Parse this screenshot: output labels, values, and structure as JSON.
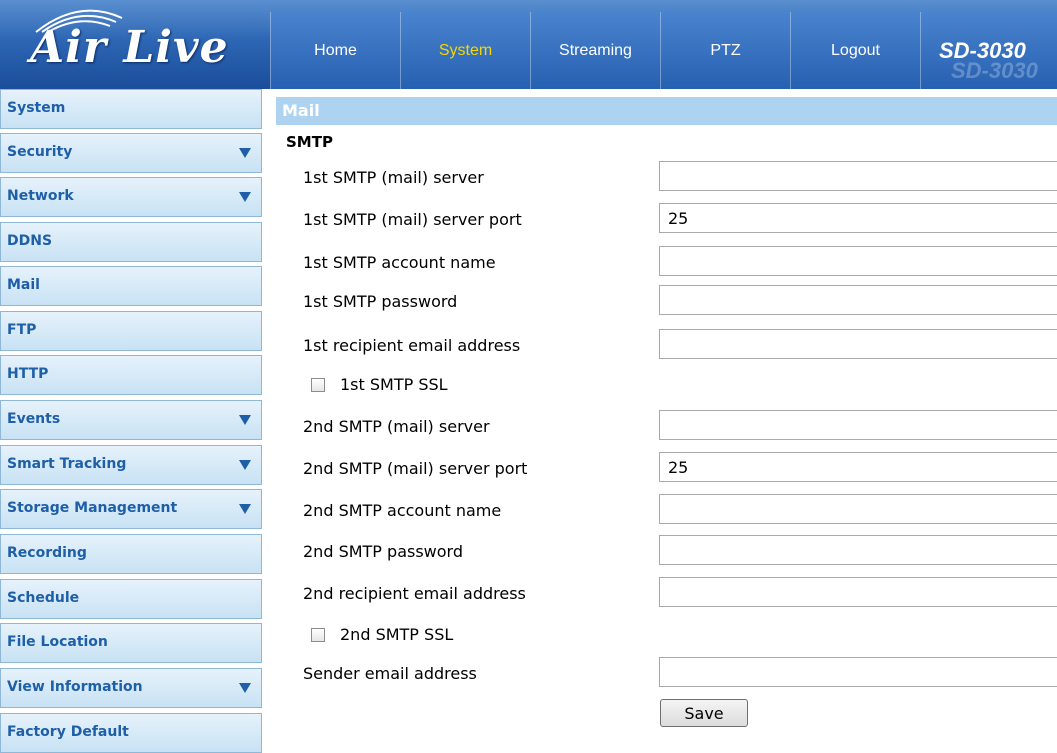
{
  "brand": {
    "logo": "Air Live",
    "model": "SD-3030"
  },
  "nav": {
    "items": [
      "Home",
      "System",
      "Streaming",
      "PTZ",
      "Logout"
    ],
    "active": "System"
  },
  "sidebar": {
    "items": [
      {
        "label": "System",
        "has_arrow": false
      },
      {
        "label": "Security",
        "has_arrow": true
      },
      {
        "label": "Network",
        "has_arrow": true
      },
      {
        "label": "DDNS",
        "has_arrow": false
      },
      {
        "label": "Mail",
        "has_arrow": false
      },
      {
        "label": "FTP",
        "has_arrow": false
      },
      {
        "label": "HTTP",
        "has_arrow": false
      },
      {
        "label": "Events",
        "has_arrow": true
      },
      {
        "label": "Smart Tracking",
        "has_arrow": true
      },
      {
        "label": "Storage Management",
        "has_arrow": true
      },
      {
        "label": "Recording",
        "has_arrow": false
      },
      {
        "label": "Schedule",
        "has_arrow": false
      },
      {
        "label": "File Location",
        "has_arrow": false
      },
      {
        "label": "View Information",
        "has_arrow": true
      },
      {
        "label": "Factory Default",
        "has_arrow": false
      }
    ]
  },
  "main": {
    "section_title": "Mail",
    "subheading": "SMTP",
    "fields": {
      "smtp1_server": {
        "label": "1st SMTP (mail) server",
        "value": ""
      },
      "smtp1_port": {
        "label": "1st SMTP (mail) server port",
        "value": "25"
      },
      "smtp1_account": {
        "label": "1st SMTP account name",
        "value": ""
      },
      "smtp1_password": {
        "label": "1st SMTP password",
        "value": ""
      },
      "recipient1": {
        "label": "1st recipient email address",
        "value": ""
      },
      "smtp1_ssl": {
        "label": "1st SMTP SSL"
      },
      "smtp2_server": {
        "label": "2nd SMTP (mail) server",
        "value": ""
      },
      "smtp2_port": {
        "label": "2nd SMTP (mail) server port",
        "value": "25"
      },
      "smtp2_account": {
        "label": "2nd SMTP account name",
        "value": ""
      },
      "smtp2_password": {
        "label": "2nd SMTP password",
        "value": ""
      },
      "recipient2": {
        "label": "2nd recipient email address",
        "value": ""
      },
      "smtp2_ssl": {
        "label": "2nd SMTP SSL"
      },
      "sender": {
        "label": "Sender email address",
        "value": ""
      }
    },
    "save_label": "Save"
  },
  "colors": {
    "header_blue": "#2d66b4",
    "active_nav": "#f4d600",
    "sidebar_text": "#1e5fa8",
    "section_bar": "#aed3f0"
  },
  "icons": {
    "dropdown": "triangle-down-icon"
  }
}
